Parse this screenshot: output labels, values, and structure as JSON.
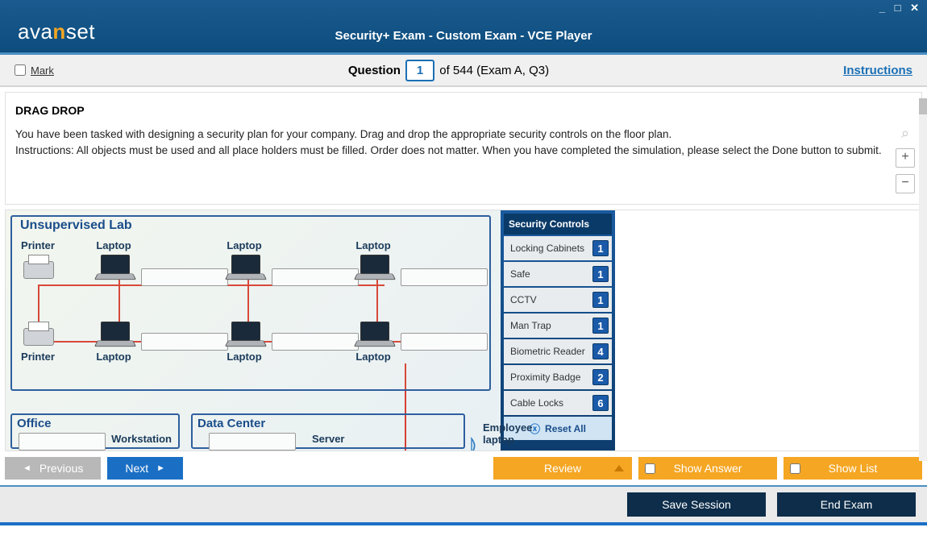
{
  "window": {
    "logo_pre": "ava",
    "logo_mid": "n",
    "logo_post": "set",
    "title": "Security+ Exam - Custom Exam - VCE Player",
    "controls": {
      "min": "_",
      "max": "□",
      "close": "✕"
    }
  },
  "subheader": {
    "mark_label": "Mark",
    "question_word": "Question",
    "question_num": "1",
    "of_text": "of 544 (Exam A, Q3)",
    "instructions_link": "Instructions"
  },
  "question": {
    "type": "DRAG DROP",
    "line1": "You have been tasked with designing a security plan for your company. Drag and drop the appropriate security controls on the floor plan.",
    "line2": "Instructions: All objects must be used and all place holders must be filled. Order does not matter. When you have completed the simulation, please select the Done button to submit."
  },
  "simulation": {
    "lab_title": "Unsupervised Lab",
    "devices": {
      "printer": "Printer",
      "laptop": "Laptop",
      "workstation": "Workstation",
      "server": "Server"
    },
    "office_title": "Office",
    "dc_title": "Data Center",
    "employee_laptop": "Employee laptop",
    "controls_header": "Security Controls",
    "controls": [
      {
        "name": "Locking Cabinets",
        "count": "1"
      },
      {
        "name": "Safe",
        "count": "1"
      },
      {
        "name": "CCTV",
        "count": "1"
      },
      {
        "name": "Man Trap",
        "count": "1"
      },
      {
        "name": "Biometric Reader",
        "count": "4"
      },
      {
        "name": "Proximity Badge",
        "count": "2"
      },
      {
        "name": "Cable Locks",
        "count": "6"
      }
    ],
    "reset_label": "Reset All"
  },
  "nav": {
    "previous": "Previous",
    "next": "Next",
    "review": "Review",
    "show_answer": "Show Answer",
    "show_list": "Show List"
  },
  "bottom": {
    "save": "Save Session",
    "end": "End Exam"
  }
}
